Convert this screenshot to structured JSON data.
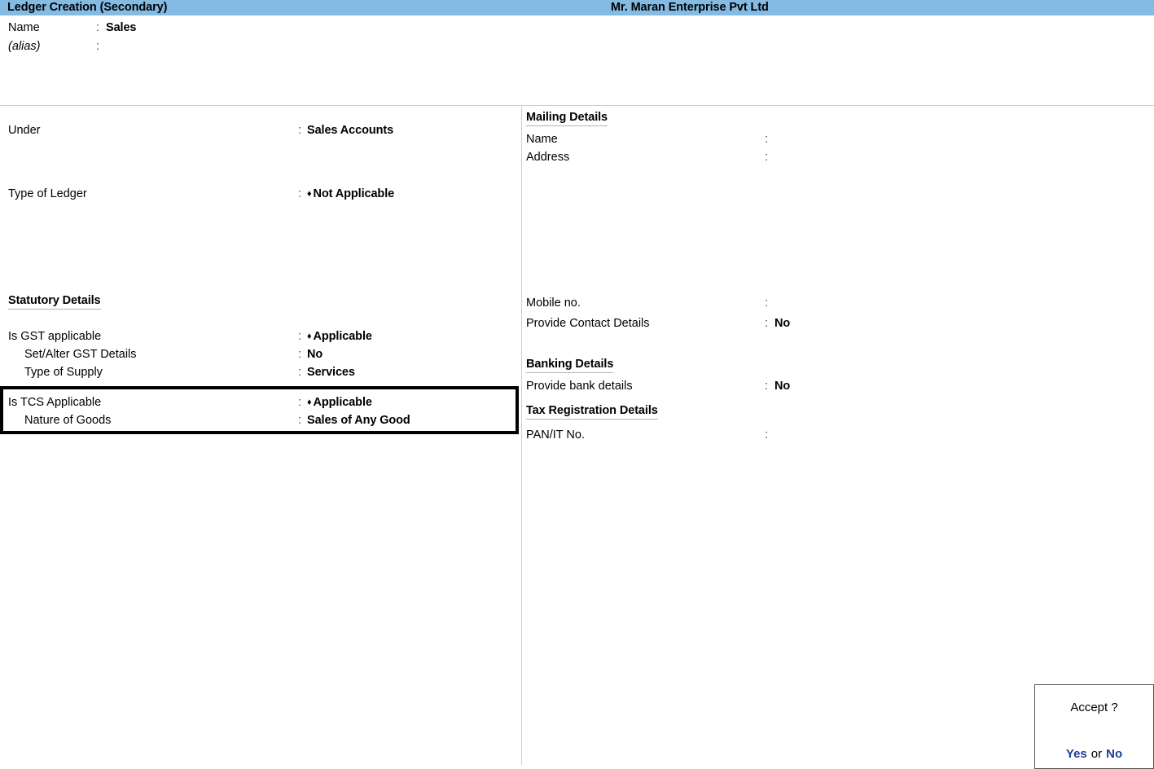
{
  "titlebar": {
    "screen_title": "Ledger Creation (Secondary)",
    "company_name": "Mr. Maran Enterprise  Pvt Ltd",
    "background_color": "#84bbe3"
  },
  "identity": {
    "name_label": "Name",
    "name_value": "Sales",
    "alias_label": "(alias)",
    "alias_value": "",
    "colon": ":"
  },
  "left_panel": {
    "under": {
      "label": "Under",
      "value": "Sales Accounts",
      "colon": ":"
    },
    "type_of_ledger": {
      "label": "Type of Ledger",
      "value": "Not Applicable",
      "marker": "♦",
      "colon": ":"
    },
    "statutory_heading": "Statutory Details",
    "is_gst_applicable": {
      "label": "Is GST applicable",
      "value": "Applicable",
      "marker": "♦",
      "colon": ":"
    },
    "set_alter_gst": {
      "label": "Set/Alter GST Details",
      "value": "No",
      "colon": ":"
    },
    "type_of_supply": {
      "label": "Type of Supply",
      "value": "Services",
      "colon": ":"
    },
    "is_tcs_applicable": {
      "label": "Is TCS Applicable",
      "value": "Applicable",
      "marker": "♦",
      "colon": ":"
    },
    "nature_of_goods": {
      "label": "Nature of Goods",
      "value": "Sales of Any Good",
      "colon": ":"
    }
  },
  "right_panel": {
    "mailing_heading": "Mailing Details",
    "mailing_name": {
      "label": "Name",
      "value": "",
      "colon": ":"
    },
    "mailing_address": {
      "label": "Address",
      "value": "",
      "colon": ":"
    },
    "mobile_no": {
      "label": "Mobile no.",
      "value": "",
      "colon": ":"
    },
    "provide_contact_details": {
      "label": "Provide Contact Details",
      "value": "No",
      "colon": ":"
    },
    "banking_heading": "Banking Details",
    "provide_bank_details": {
      "label": "Provide bank details",
      "value": "No",
      "colon": ":"
    },
    "tax_registration_heading": "Tax Registration Details",
    "pan_it_no": {
      "label": "PAN/IT No.",
      "value": "",
      "colon": ":"
    }
  },
  "accept_dialog": {
    "title": "Accept ?",
    "yes_label": "Yes",
    "or_label": "or",
    "no_label": "No",
    "link_color": "#1f3d99"
  }
}
